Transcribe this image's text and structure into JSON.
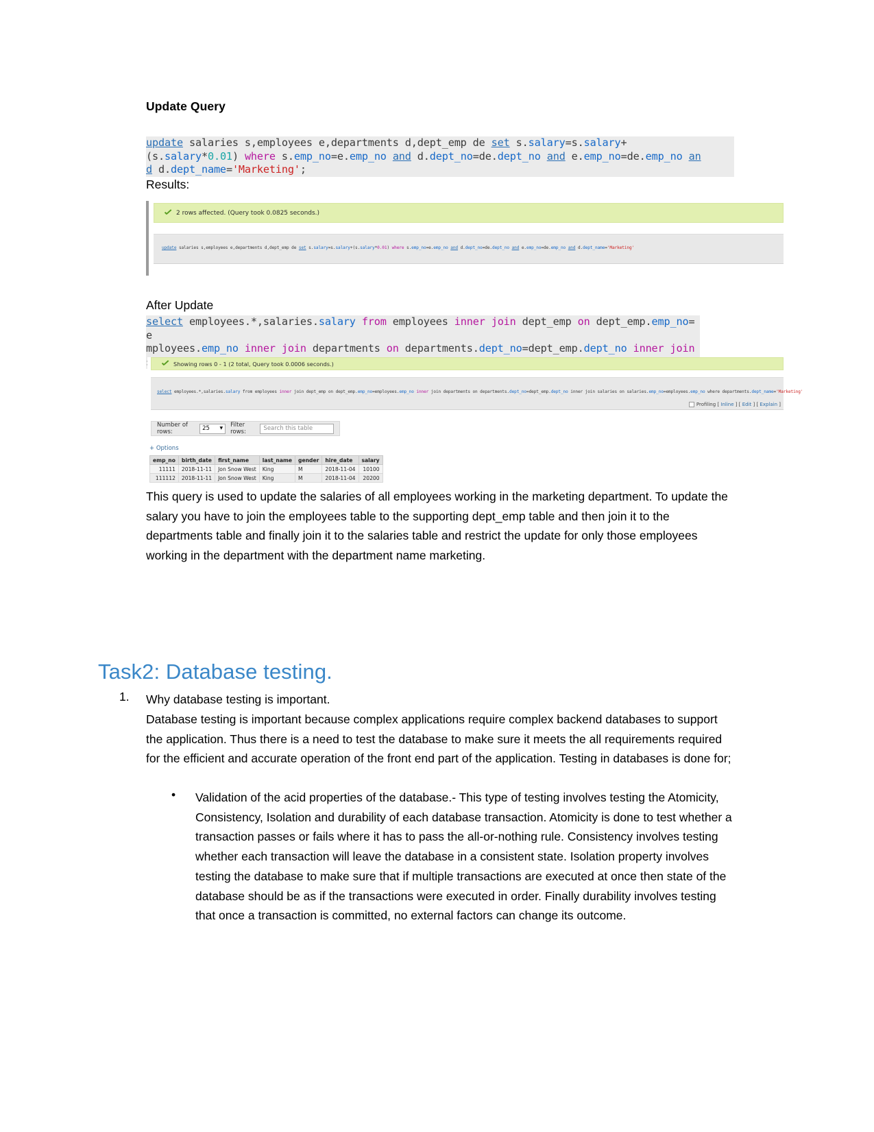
{
  "section1": {
    "heading": "Update Query",
    "update_query_lines": [
      [
        {
          "t": "update",
          "c": "kw-u"
        },
        {
          "t": " salaries s,employees e,departments d,dept_emp de ",
          "c": "plain"
        },
        {
          "t": "set",
          "c": "kw-u"
        },
        {
          "t": " s.",
          "c": "plain"
        },
        {
          "t": "salary",
          "c": "kw-b"
        },
        {
          "t": "=s.",
          "c": "plain"
        },
        {
          "t": "salary",
          "c": "kw-b"
        },
        {
          "t": "+",
          "c": "plain"
        }
      ],
      [
        {
          "t": "(s.",
          "c": "plain"
        },
        {
          "t": "salary",
          "c": "kw-b"
        },
        {
          "t": "*",
          "c": "plain"
        },
        {
          "t": "0.01",
          "c": "kw-t"
        },
        {
          "t": ") ",
          "c": "plain"
        },
        {
          "t": "where",
          "c": "kw-m"
        },
        {
          "t": " s.",
          "c": "plain"
        },
        {
          "t": "emp_no",
          "c": "kw-b"
        },
        {
          "t": "=e.",
          "c": "plain"
        },
        {
          "t": "emp_no",
          "c": "kw-b"
        },
        {
          "t": " ",
          "c": "plain"
        },
        {
          "t": "and",
          "c": "kw-u"
        },
        {
          "t": " d.",
          "c": "plain"
        },
        {
          "t": "dept_no",
          "c": "kw-b"
        },
        {
          "t": "=de.",
          "c": "plain"
        },
        {
          "t": "dept_no",
          "c": "kw-b"
        },
        {
          "t": " ",
          "c": "plain"
        },
        {
          "t": "and",
          "c": "kw-u"
        },
        {
          "t": " e.",
          "c": "plain"
        },
        {
          "t": "emp_no",
          "c": "kw-b"
        },
        {
          "t": "=de.",
          "c": "plain"
        },
        {
          "t": "emp_no",
          "c": "kw-b"
        },
        {
          "t": " ",
          "c": "plain"
        },
        {
          "t": "an",
          "c": "kw-u"
        }
      ],
      [
        {
          "t": "d",
          "c": "kw-u"
        },
        {
          "t": " d.",
          "c": "plain"
        },
        {
          "t": "dept_name",
          "c": "kw-b"
        },
        {
          "t": "=",
          "c": "plain"
        },
        {
          "t": "'Marketing'",
          "c": "kw-s"
        },
        {
          "t": ";",
          "c": "plain"
        }
      ]
    ],
    "update_query_plain": "update salaries s,employees e,departments d,dept_emp de set s.salary=s.salary+(s.salary*0.01) where s.emp_no=e.emp_no and d.dept_no=de.dept_no and e.emp_no=de.emp_no and d.dept_name='Marketing';",
    "results_label": "Results:",
    "update_result": {
      "status": "2 rows affected. (Query took 0.0825 seconds.)",
      "echo_segments": [
        {
          "t": "update",
          "c": "q-u"
        },
        {
          "t": " salaries s,employees e,departments d,dept_emp de ",
          "c": ""
        },
        {
          "t": "set",
          "c": "q-u"
        },
        {
          "t": " s.",
          "c": ""
        },
        {
          "t": "salary",
          "c": "q-b"
        },
        {
          "t": "=s.",
          "c": ""
        },
        {
          "t": "salary",
          "c": "q-b"
        },
        {
          "t": "+(s.",
          "c": ""
        },
        {
          "t": "salary",
          "c": "q-b"
        },
        {
          "t": "*",
          "c": ""
        },
        {
          "t": "0.01",
          "c": "q-m"
        },
        {
          "t": ") ",
          "c": ""
        },
        {
          "t": "where",
          "c": "q-m"
        },
        {
          "t": " s.",
          "c": ""
        },
        {
          "t": "emp_no",
          "c": "q-b"
        },
        {
          "t": "=e.",
          "c": ""
        },
        {
          "t": "emp_no",
          "c": "q-b"
        },
        {
          "t": " ",
          "c": ""
        },
        {
          "t": "and",
          "c": "q-u"
        },
        {
          "t": " d.",
          "c": ""
        },
        {
          "t": "dept_no",
          "c": "q-b"
        },
        {
          "t": "=de.",
          "c": ""
        },
        {
          "t": "dept_no",
          "c": "q-b"
        },
        {
          "t": " ",
          "c": ""
        },
        {
          "t": "and",
          "c": "q-u"
        },
        {
          "t": " e.",
          "c": ""
        },
        {
          "t": "emp_no",
          "c": "q-b"
        },
        {
          "t": "=de.",
          "c": ""
        },
        {
          "t": "emp_no",
          "c": "q-b"
        },
        {
          "t": " ",
          "c": ""
        },
        {
          "t": "and",
          "c": "q-u"
        },
        {
          "t": " d.",
          "c": ""
        },
        {
          "t": "dept_name",
          "c": "q-b"
        },
        {
          "t": "=",
          "c": ""
        },
        {
          "t": "'Marketing'",
          "c": "q-s"
        }
      ]
    }
  },
  "section2": {
    "heading": "After Update",
    "select_query_lines": [
      [
        {
          "t": "select",
          "c": "kw-u"
        },
        {
          "t": " employees.*,salaries.",
          "c": "plain"
        },
        {
          "t": "salary",
          "c": "kw-b"
        },
        {
          "t": " ",
          "c": "plain"
        },
        {
          "t": "from",
          "c": "kw-m"
        },
        {
          "t": " employees ",
          "c": "plain"
        },
        {
          "t": "inner join",
          "c": "kw-m"
        },
        {
          "t": " dept_emp ",
          "c": "plain"
        },
        {
          "t": "on",
          "c": "kw-m"
        },
        {
          "t": " dept_emp.",
          "c": "plain"
        },
        {
          "t": "emp_no",
          "c": "kw-b"
        },
        {
          "t": "=e",
          "c": "plain"
        }
      ],
      [
        {
          "t": "mployees.",
          "c": "plain"
        },
        {
          "t": "emp_no",
          "c": "kw-b"
        },
        {
          "t": " ",
          "c": "plain"
        },
        {
          "t": "inner join",
          "c": "kw-m"
        },
        {
          "t": " departments ",
          "c": "plain"
        },
        {
          "t": "on",
          "c": "kw-m"
        },
        {
          "t": " departments.",
          "c": "plain"
        },
        {
          "t": "dept_no",
          "c": "kw-b"
        },
        {
          "t": "=dept_emp.",
          "c": "plain"
        },
        {
          "t": "dept_no",
          "c": "kw-b"
        },
        {
          "t": " ",
          "c": "plain"
        },
        {
          "t": "inner join",
          "c": "kw-m"
        }
      ],
      [
        {
          "t": "salaries ",
          "c": "plain"
        },
        {
          "t": "on",
          "c": "kw-m"
        },
        {
          "t": " salaries.",
          "c": "plain"
        },
        {
          "t": "emp_no",
          "c": "kw-b"
        },
        {
          "t": "=employees.",
          "c": "plain"
        },
        {
          "t": "emp_no",
          "c": "kw-b"
        },
        {
          "t": " ",
          "c": "plain"
        },
        {
          "t": "where",
          "c": "kw-m"
        },
        {
          "t": " departments.",
          "c": "plain"
        },
        {
          "t": "dept_name",
          "c": "kw-b"
        },
        {
          "t": "=",
          "c": "plain"
        },
        {
          "t": "'Marketing'",
          "c": "kw-s"
        },
        {
          "t": ";",
          "c": "plain"
        }
      ]
    ],
    "select_query_plain": "select employees.*,salaries.salary from employees inner join dept_emp on dept_emp.emp_no=employees.emp_no inner join departments on departments.dept_no=dept_emp.dept_no inner join salaries on salaries.emp_no=employees.emp_no where departments.dept_name='Marketing';",
    "select_result": {
      "status": "Showing rows 0 - 1 (2 total, Query took 0.0006 seconds.)",
      "echo_segments": [
        {
          "t": "select",
          "c": "q-u"
        },
        {
          "t": " employees.*,salaries.",
          "c": ""
        },
        {
          "t": "salary",
          "c": "q-b"
        },
        {
          "t": " from employees ",
          "c": ""
        },
        {
          "t": "inner",
          "c": "q-m"
        },
        {
          "t": " join dept_emp on dept_emp.",
          "c": ""
        },
        {
          "t": "emp_no",
          "c": "q-b"
        },
        {
          "t": "=employees.",
          "c": ""
        },
        {
          "t": "emp_no",
          "c": "q-b"
        },
        {
          "t": " ",
          "c": ""
        },
        {
          "t": "inner",
          "c": "q-m"
        },
        {
          "t": " join departments on departments.",
          "c": ""
        },
        {
          "t": "dept_no",
          "c": "q-b"
        },
        {
          "t": "=dept_emp.",
          "c": ""
        },
        {
          "t": "dept_no",
          "c": "q-b"
        },
        {
          "t": " inner join salaries on salaries.",
          "c": ""
        },
        {
          "t": "emp_no",
          "c": "q-b"
        },
        {
          "t": "=employees.",
          "c": ""
        },
        {
          "t": "emp_no",
          "c": "q-b"
        },
        {
          "t": " where departments.",
          "c": ""
        },
        {
          "t": "dept_name",
          "c": "q-b"
        },
        {
          "t": "=",
          "c": ""
        },
        {
          "t": "'Marketing'",
          "c": "q-s"
        }
      ],
      "profiling_label": "Profiling",
      "profiling_links": [
        "Inline",
        "Edit",
        "Explain"
      ],
      "toolbar": {
        "rows_label": "Number of rows:",
        "rows_value": "25",
        "filter_label": "Filter rows:",
        "filter_placeholder": "Search this table"
      },
      "options_label": "+ Options",
      "table": {
        "columns": [
          "emp_no",
          "birth_date",
          "first_name",
          "last_name",
          "gender",
          "hire_date",
          "salary"
        ],
        "rows": [
          [
            "11111",
            "2018-11-11",
            "Jon Snow West",
            "King",
            "M",
            "2018-11-04",
            "10100"
          ],
          [
            "111112",
            "2018-11-11",
            "Jon Snow West",
            "King",
            "M",
            "2018-11-04",
            "20200"
          ]
        ]
      }
    },
    "explanation": "This query is used to update the salaries of all employees working in the marketing department. To update the salary you have to join the employees table to the supporting dept_emp table and then join it to the departments table and finally join it to the salaries table and restrict the update for only those employees working in the department with the department name marketing."
  },
  "task2": {
    "title": "Task2: Database testing.",
    "item_number": "1.",
    "question": "Why database testing is important.",
    "answer": "Database testing is important because complex applications require complex backend databases to support the application. Thus there is a need to test the database to make sure it meets the all requirements required for the efficient and accurate operation of the front end part of the application. Testing in databases is done for;",
    "bullet_marker": "•",
    "bullet": "Validation of the acid properties of the database.- This type of testing involves testing the Atomicity, Consistency, Isolation and durability of each database transaction. Atomicity is done to test whether a transaction passes or fails where it has to pass the all-or-nothing rule. Consistency involves testing whether each transaction will leave the database in a consistent state. Isolation property involves testing the database to make sure that if multiple transactions are executed at once then state of the database should be as if the transactions were executed in order. Finally durability involves testing that once a transaction is committed, no external factors can change its outcome."
  }
}
